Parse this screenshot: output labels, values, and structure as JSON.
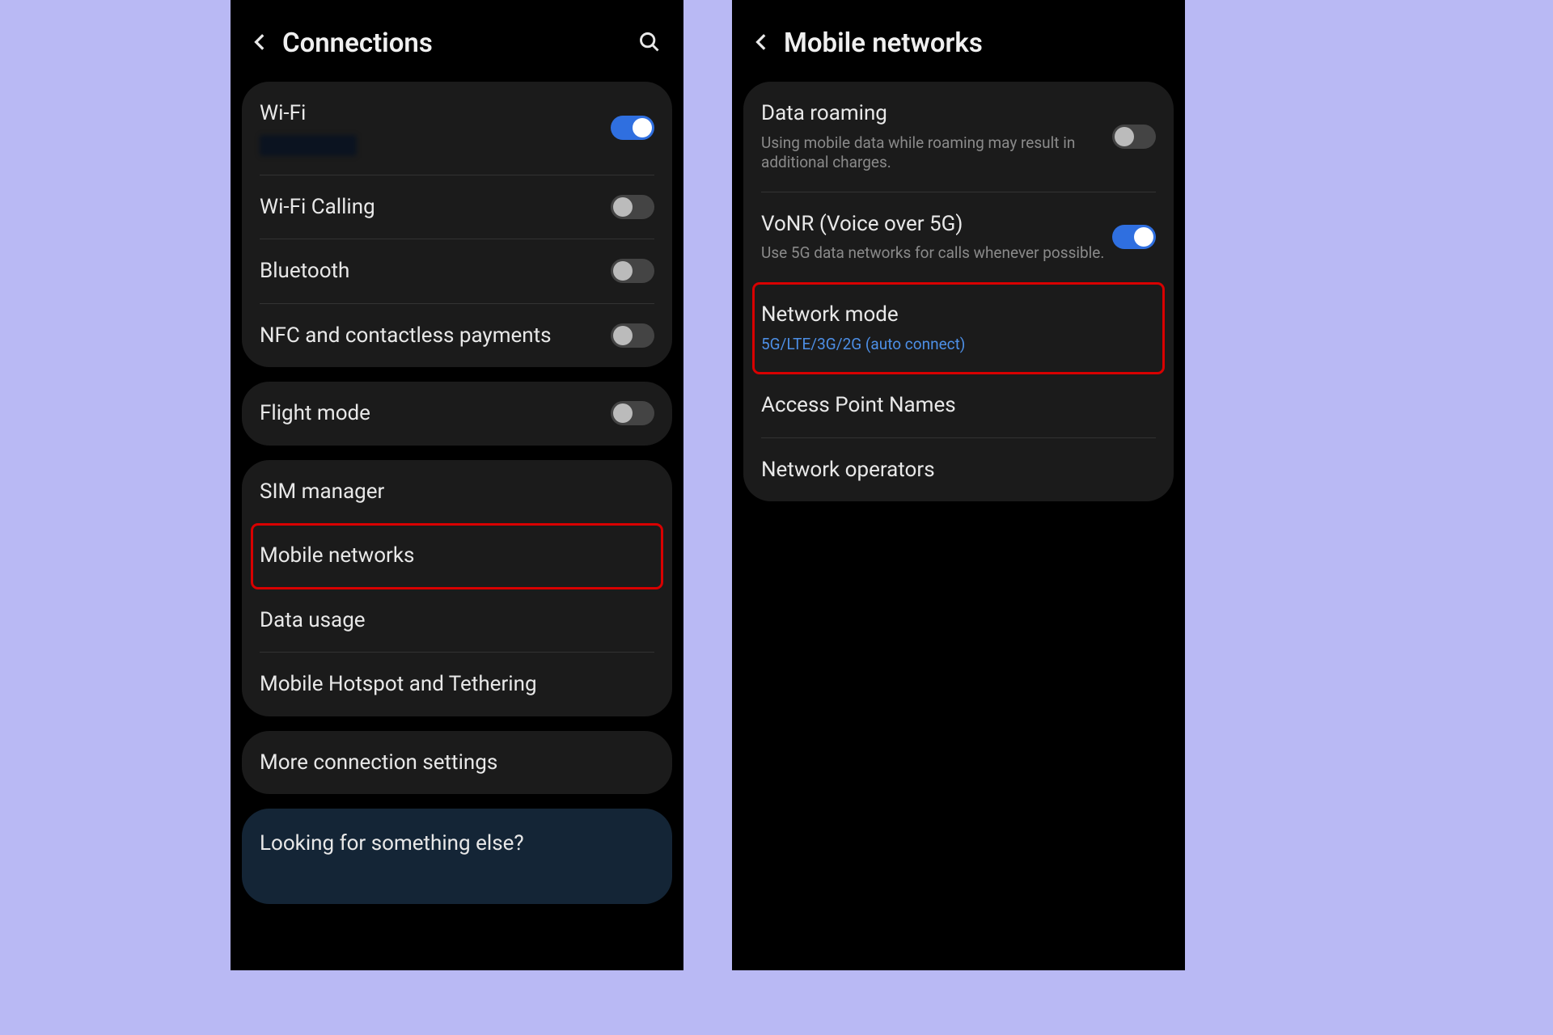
{
  "left": {
    "title": "Connections",
    "groups": [
      [
        {
          "label": "Wi-Fi",
          "toggle": "on",
          "wifiBlur": true
        },
        {
          "label": "Wi-Fi Calling",
          "toggle": "off"
        },
        {
          "label": "Bluetooth",
          "toggle": "off"
        },
        {
          "label": "NFC and contactless payments",
          "toggle": "off"
        }
      ],
      [
        {
          "label": "Flight mode",
          "toggle": "off"
        }
      ],
      [
        {
          "label": "SIM manager"
        },
        {
          "label": "Mobile networks",
          "highlight": true
        },
        {
          "label": "Data usage"
        },
        {
          "label": "Mobile Hotspot and Tethering"
        }
      ],
      [
        {
          "label": "More connection settings"
        }
      ]
    ],
    "help": "Looking for something else?"
  },
  "right": {
    "title": "Mobile networks",
    "rows": [
      {
        "label": "Data roaming",
        "sub": "Using mobile data while roaming may result in additional charges.",
        "toggle": "off"
      },
      {
        "label": "VoNR (Voice over 5G)",
        "sub": "Use 5G data networks for calls whenever possible.",
        "toggle": "on"
      },
      {
        "label": "Network mode",
        "sub": "5G/LTE/3G/2G (auto connect)",
        "subBlue": true,
        "highlight": true
      },
      {
        "label": "Access Point Names"
      },
      {
        "label": "Network operators"
      }
    ]
  }
}
